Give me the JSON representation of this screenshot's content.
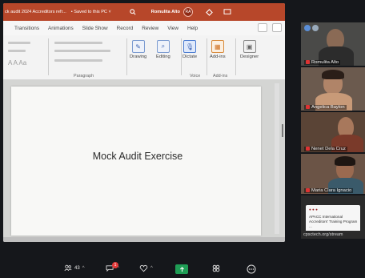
{
  "titlebar": {
    "document_name": "ck audit 2024 Accreditors refr...",
    "saved_status": "• Saved to this PC ˅",
    "user_name": "Romulita Alto",
    "user_initials": "RA"
  },
  "tabs": [
    "Transitions",
    "Animations",
    "Slide Show",
    "Record",
    "Review",
    "View",
    "Help"
  ],
  "ribbon": {
    "paragraph_label": "Paragraph",
    "drawing_label": "Drawing",
    "editing_label": "Editing",
    "dictate_label": "Dictate",
    "addins_label": "Add-ins",
    "designer_label": "Designer",
    "voice_group": "Voice",
    "addins_group": "Add-ins",
    "font_row_left": "A  A  Aa"
  },
  "slide": {
    "title": "Mock Audit Exercise"
  },
  "participants": [
    {
      "name": "Romulita Alto"
    },
    {
      "name": "Angelica Baylon"
    },
    {
      "name": "Nenet Dela Cruz"
    },
    {
      "name": "Maria Clara Ignacio"
    }
  ],
  "shared_card": {
    "line1": "APACC International",
    "line2": "Accreditors' Training Program",
    "line3": "...",
    "url": "cpsctech.org/stream"
  },
  "toolbar": {
    "participants_count": "43",
    "chat_badge": "1"
  },
  "colors": {
    "ppt_brand": "#b7472a",
    "share_green": "#1f9d55",
    "notification_red": "#e23a3a"
  }
}
